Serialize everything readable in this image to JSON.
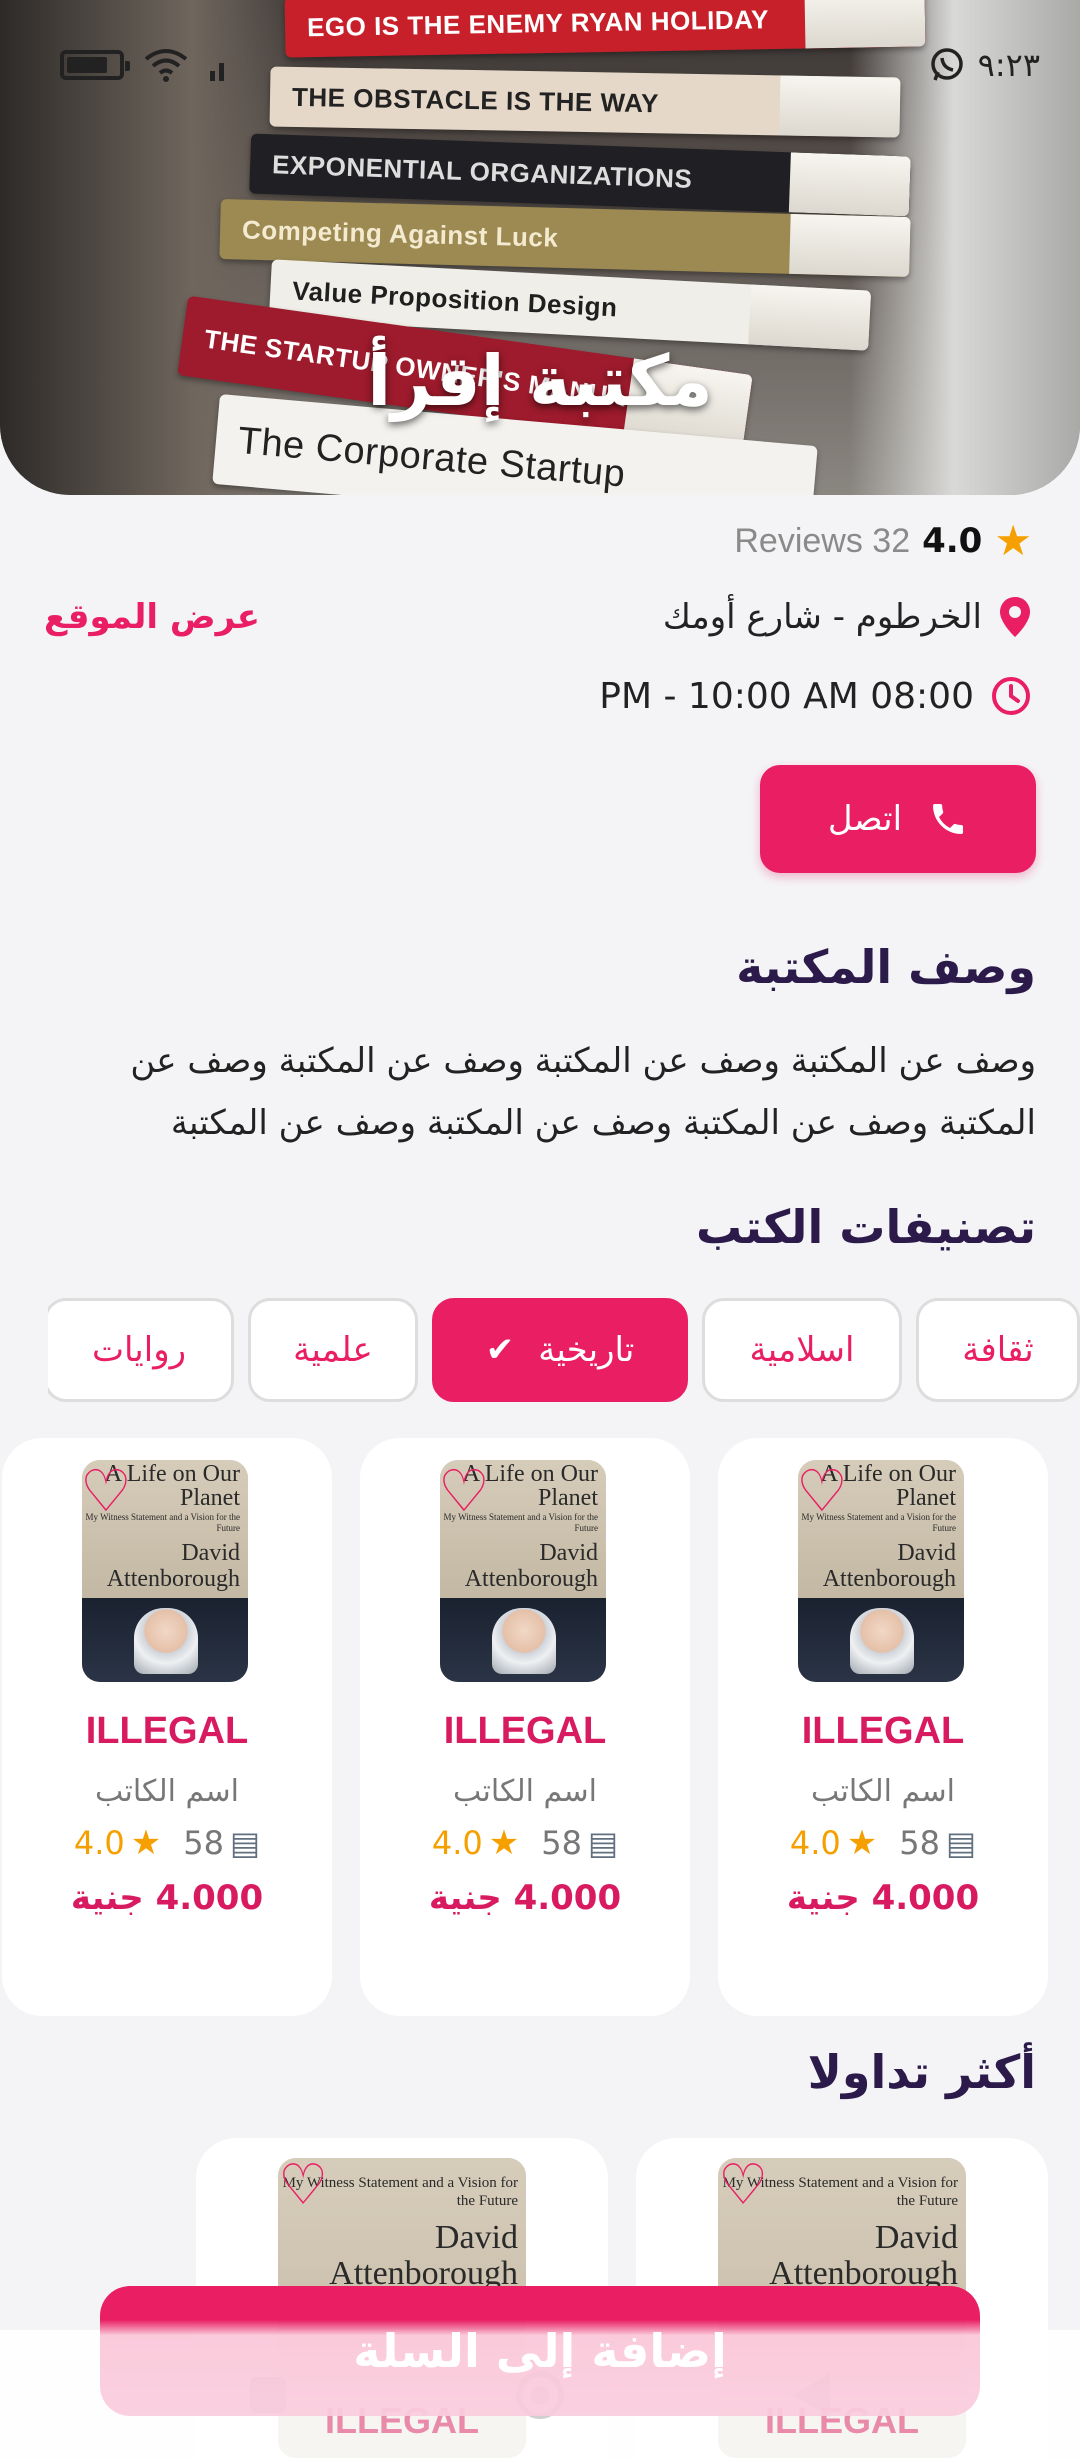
{
  "status_bar": {
    "time": "٩:٢٣"
  },
  "hero": {
    "title": "مكتبة إقرأ",
    "books": [
      {
        "text": "EGO IS THE ENEMY     RYAN HOLIDAY",
        "color": "#c8202a"
      },
      {
        "text": "THE OBSTACLE IS THE WAY",
        "color": "#e6d8c8"
      },
      {
        "text": "EXPONENTIAL ORGANIZATIONS",
        "color": "#1f1f24"
      },
      {
        "text": "Competing Against Luck",
        "color": "#9c8a52"
      },
      {
        "text": "Value Proposition Design",
        "color": "#f0eee8"
      },
      {
        "text": "THE STARTUP OWNER'S MANUAL",
        "color": "#9d1b2c"
      },
      {
        "text": "The Corporate Startup",
        "color": "#f4f2ee"
      }
    ]
  },
  "rating": {
    "value": "4.0",
    "reviews": "Reviews 32"
  },
  "location": {
    "address": "الخرطوم - شارع أومك",
    "map_link": "عرض الموقع"
  },
  "hours": {
    "text": "PM - 10:00 AM 08:00"
  },
  "call_button": {
    "label": "اتصل"
  },
  "description": {
    "title": "وصف المكتبة",
    "text": "وصف عن المكتبة وصف عن المكتبة وصف عن المكتبة وصف عن المكتبة وصف عن المكتبة وصف عن المكتبة وصف عن المكتبة"
  },
  "categories": {
    "title": "تصنيفات الكتب",
    "chips": [
      {
        "label": "ثقافة",
        "active": false
      },
      {
        "label": "اسلامية",
        "active": false
      },
      {
        "label": "تاريخية",
        "active": true
      },
      {
        "label": "علمية",
        "active": false
      },
      {
        "label": "روايات",
        "active": false
      }
    ]
  },
  "book_cover": {
    "title": "A Life on Our Planet",
    "subtitle": "My Witness Statement and a Vision for the Future",
    "author": "David Attenborough"
  },
  "books": [
    {
      "title": "ILLEGAL",
      "author": "اسم الكاتب",
      "pages": "58",
      "rating": "4.0",
      "price": "4.000 جنية"
    },
    {
      "title": "ILLEGAL",
      "author": "اسم الكاتب",
      "pages": "58",
      "rating": "4.0",
      "price": "4.000 جنية"
    },
    {
      "title": "ILLEGAL",
      "author": "اسم الكاتب",
      "pages": "58",
      "rating": "4.0",
      "price": "4.000 جنية"
    }
  ],
  "trending": {
    "title": "أكثر تداولا",
    "items": [
      {
        "title": "ILLEGAL"
      },
      {
        "title": "ILLEGAL"
      }
    ]
  },
  "cart_button": {
    "label": "إضافة إلى السلة"
  },
  "colors": {
    "accent": "#e91e63",
    "heading": "#2b1a4a",
    "star": "#f5a000"
  }
}
